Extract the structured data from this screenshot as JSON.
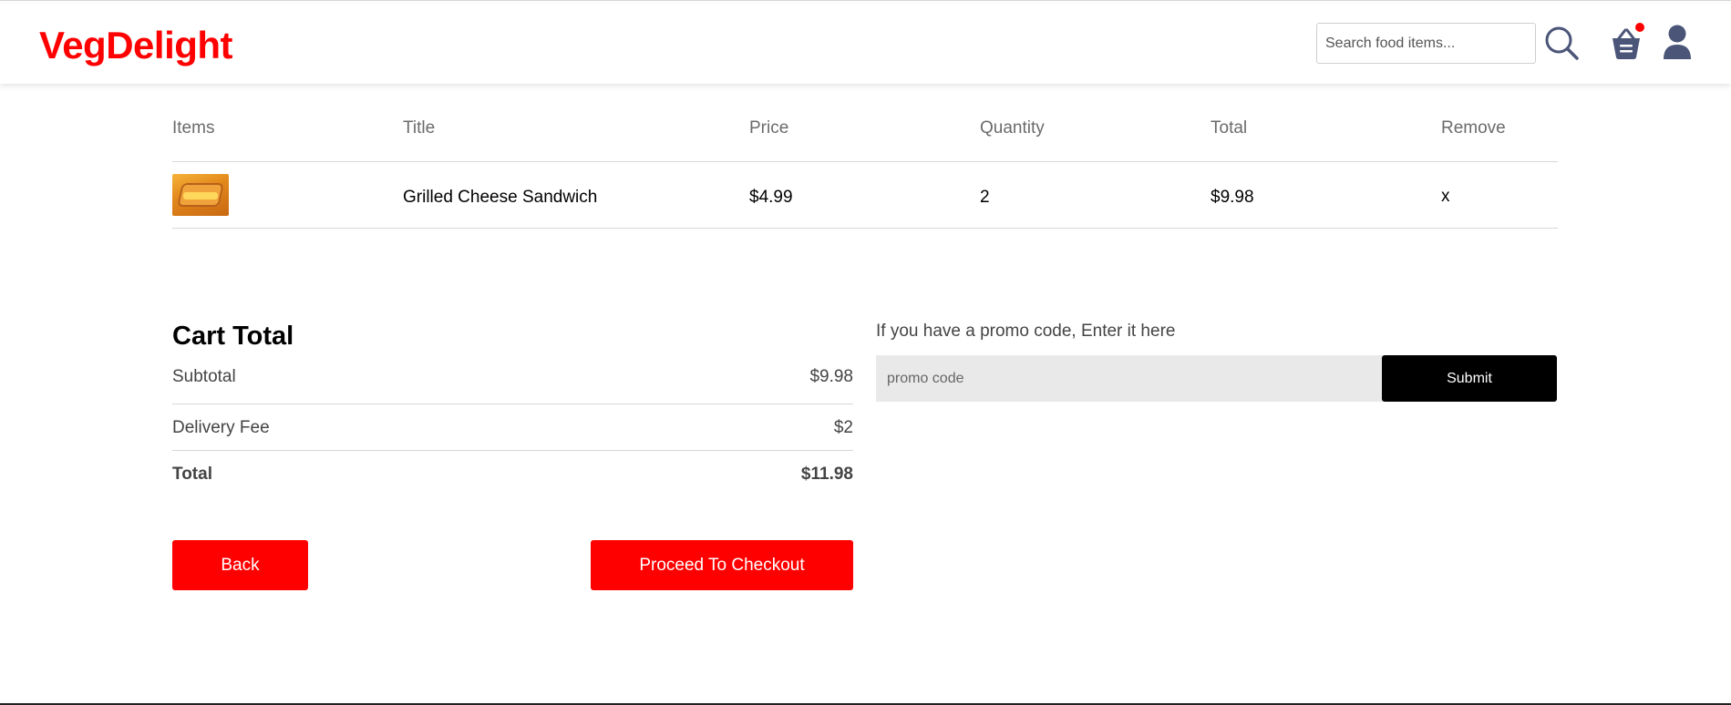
{
  "brand": {
    "logo": "VegDelight",
    "accent": "#ff0000"
  },
  "header": {
    "search_placeholder": "Search food items...",
    "icons": [
      "search-icon",
      "basket-icon",
      "profile-icon"
    ],
    "cart_has_items": true
  },
  "table": {
    "headers": [
      "Items",
      "Title",
      "Price",
      "Quantity",
      "Total",
      "Remove"
    ],
    "rows": [
      {
        "title": "Grilled Cheese Sandwich",
        "price": "$4.99",
        "quantity": "2",
        "total": "$9.98",
        "remove": "x"
      }
    ]
  },
  "cart_total": {
    "heading": "Cart Total",
    "subtotal_label": "Subtotal",
    "subtotal_value": "$9.98",
    "delivery_label": "Delivery Fee",
    "delivery_value": "$2",
    "total_label": "Total",
    "total_value": "$11.98"
  },
  "buttons": {
    "back": "Back",
    "checkout": "Proceed To Checkout"
  },
  "promo": {
    "label": "If you have a promo code, Enter it here",
    "placeholder": "promo code",
    "submit": "Submit"
  }
}
